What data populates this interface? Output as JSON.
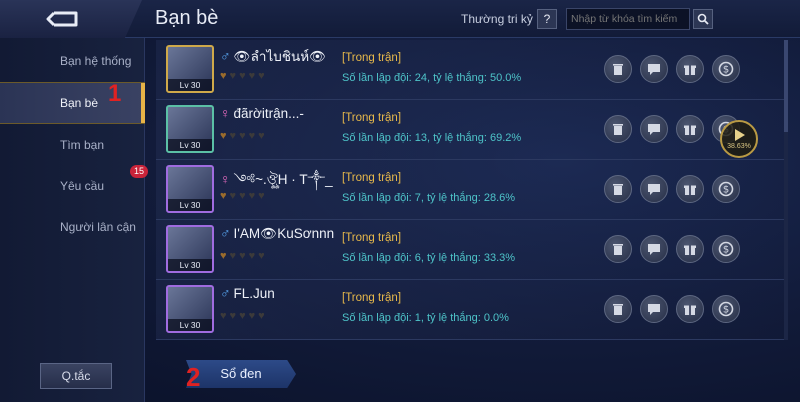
{
  "header": {
    "title": "Bạn bè",
    "bff_label": "Thường tri kỷ",
    "help_label": "?",
    "search_placeholder": "Nhập từ khóa tìm kiếm"
  },
  "sidebar": {
    "items": [
      {
        "label": "Bạn hệ thống"
      },
      {
        "label": "Bạn bè"
      },
      {
        "label": "Tìm bạn"
      },
      {
        "label": "Yêu cầu"
      },
      {
        "label": "Người lân cận"
      }
    ],
    "request_badge": "15",
    "rules_label": "Q.tắc"
  },
  "annotations": {
    "marker_1": "1",
    "marker_2": "2"
  },
  "friends": [
    {
      "gender": "♂",
      "name": "👁ลำไบชินห์👁",
      "level": "Lv 30",
      "status": "[Trong trận]",
      "stats": "Số lần lập đội: 24, tỷ lệ thắng: 50.0%",
      "hearts_on": 1
    },
    {
      "gender": "♀",
      "name": "đãrờitrận...-",
      "level": "Lv 30",
      "status": "[Trong trận]",
      "stats": "Số lần lập đội: 13, tỷ lệ thắng: 69.2%",
      "hearts_on": 1
    },
    {
      "gender": "♀",
      "name": "༺~.ঔৣH · T༒_",
      "level": "Lv 30",
      "status": "[Trong trận]",
      "stats": "Số lần lập đội: 7, tỷ lệ thắng: 28.6%",
      "hearts_on": 1
    },
    {
      "gender": "♂",
      "name": "I'AM👁KuSơnnn",
      "level": "Lv 30",
      "status": "[Trong trận]",
      "stats": "Số lần lập đội: 6, tỷ lệ thắng: 33.3%",
      "hearts_on": 1
    },
    {
      "gender": "♂",
      "name": "FL.Jun",
      "level": "Lv 30",
      "status": "[Trong trận]",
      "stats": "Số lần lập đội: 1, tỷ lệ thắng: 0.0%",
      "hearts_on": 0
    }
  ],
  "overlay": {
    "percent": "38.63%"
  },
  "footer": {
    "blacklist_label": "Sổ đen"
  },
  "icons": {
    "back": "back-arrow-icon",
    "search": "search-icon",
    "delete": "trash-icon",
    "chat": "chat-icon",
    "gift": "gift-icon",
    "coin": "coin-icon",
    "play": "play-icon"
  }
}
